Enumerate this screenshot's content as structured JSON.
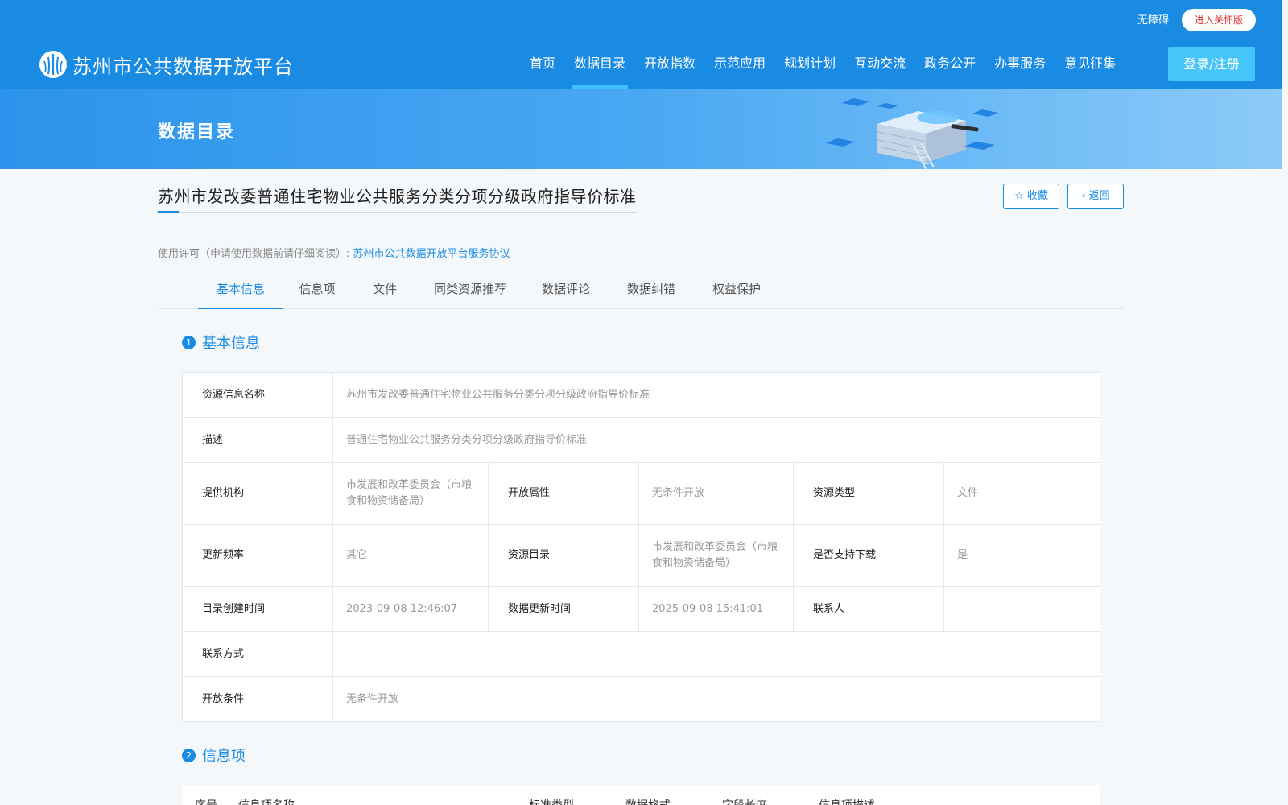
{
  "topbar": {
    "accessibility": "无障碍",
    "care_mode": "进入关怀版"
  },
  "brand": {
    "name": "苏州市公共数据开放平台"
  },
  "nav": {
    "items": [
      "首页",
      "数据目录",
      "开放指数",
      "示范应用",
      "规划计划",
      "互动交流",
      "政务公开",
      "办事服务",
      "意见征集"
    ],
    "active": "数据目录",
    "login": "登录/注册"
  },
  "banner": {
    "title": "数据目录"
  },
  "detail": {
    "title": "苏州市发改委普通住宅物业公共服务分类分项分级政府指导价标准",
    "favorite": "收藏",
    "back": "返回",
    "license_label": "使用许可（申请使用数据前请仔细阅读）:",
    "license_link": "苏州市公共数据开放平台服务协议"
  },
  "tabs": [
    "基本信息",
    "信息项",
    "文件",
    "同类资源推荐",
    "数据评论",
    "数据纠错",
    "权益保护"
  ],
  "section1": {
    "num": "1",
    "title": "基本信息"
  },
  "section2": {
    "num": "2",
    "title": "信息项"
  },
  "basic_info": {
    "resource_name_label": "资源信息名称",
    "resource_name": "苏州市发改委普通住宅物业公共服务分类分项分级政府指导价标准",
    "desc_label": "描述",
    "desc": "普通住宅物业公共服务分类分项分级政府指导价标准",
    "provider_label": "提供机构",
    "provider": "市发展和改革委员会（市粮食和物资储备局）",
    "open_attr_label": "开放属性",
    "open_attr": "无条件开放",
    "resource_type_label": "资源类型",
    "resource_type": "文件",
    "update_freq_label": "更新频率",
    "update_freq": "其它",
    "catalog_label": "资源目录",
    "catalog": "市发展和改革委员会（市粮食和物资储备局）",
    "download_label": "是否支持下载",
    "download": "是",
    "created_label": "目录创建时间",
    "created": "2023-09-08 12:46:07",
    "updated_label": "数据更新时间",
    "updated": "2025-09-08 15:41:01",
    "contact_label": "联系人",
    "contact": "-",
    "contact_method_label": "联系方式",
    "contact_method": "-",
    "open_cond_label": "开放条件",
    "open_cond": "无条件开放"
  },
  "items_table": {
    "headers": [
      "序号",
      "信息项名称",
      "标准类型",
      "数据格式",
      "字段长度",
      "信息项描述"
    ]
  },
  "colors": {
    "primary": "#1a8be3",
    "login": "#46c5fb",
    "care_text": "#e2302c"
  }
}
